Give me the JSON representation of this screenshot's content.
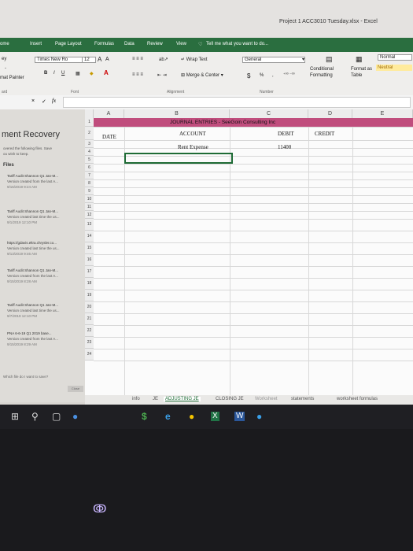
{
  "window": {
    "title": "Project 1 ACC3010 Tuesday.xlsx - Excel"
  },
  "ribbon": {
    "tabs": [
      "ome",
      "Insert",
      "Page Layout",
      "Formulas",
      "Data",
      "Review",
      "View"
    ],
    "tell_me": "Tell me what you want to do...",
    "clipboard": {
      "cut": "ey",
      "copy": "-",
      "format_painter": "mat Painter",
      "group": "ard"
    },
    "font": {
      "name": "Times New Ro",
      "size": "12",
      "grow": "A",
      "shrink": "A",
      "bold": "B",
      "italic": "I",
      "underline": "U",
      "group": "Font"
    },
    "alignment": {
      "wrap": "Wrap Text",
      "merge": "Merge & Center",
      "group": "Alignment"
    },
    "number": {
      "format": "General",
      "currency": "$",
      "percent": "%",
      "comma": ",",
      "group": "Number"
    },
    "styles": {
      "conditional": "Conditional Formatting",
      "format_as": "Format as Table",
      "normal": "Normal",
      "neutral": "Neutral"
    }
  },
  "formula_bar": {
    "cancel": "×",
    "enter": "✓",
    "fx": "fx"
  },
  "recovery": {
    "title": "ment Recovery",
    "line1": "overed the following files. Save",
    "line2": "ou wish to keep.",
    "files_header": "Files",
    "items": [
      {
        "name": "Tariff Audit Shannon Q1 Jan-M...",
        "desc": "Version created from the last A...",
        "time": "9/16/2019 9:24 AM"
      },
      {
        "name": "Tariff Audit Shannon Q1 Jan-M...",
        "desc": "Version created last time the us...",
        "time": "9/1/2019 12:10 PM"
      },
      {
        "name": "https://gdavis.eltra.chrysler.co...",
        "desc": "Version created last time the us...",
        "time": "9/13/2019 9:46 AM"
      },
      {
        "name": "Tariff Audit Shannon Q1 Jan-M...",
        "desc": "Version created from the last A...",
        "time": "9/15/2019 8:28 AM"
      },
      {
        "name": "Tariff Audit Shannon Q1 Jan-M...",
        "desc": "Version created last time the us...",
        "time": "9/7/2019 12:10 PM"
      },
      {
        "name": "PNA 6-6-19 Q1 2019 base...",
        "desc": "Version created from the last A...",
        "time": "9/15/2019 8:29 AM"
      }
    ],
    "footer": "Which file do I want to save?",
    "close": "Close"
  },
  "sheet": {
    "columns": [
      "A",
      "B",
      "C",
      "D",
      "E"
    ],
    "rows": [
      "1",
      "2",
      "3",
      "4",
      "5",
      "6",
      "7",
      "8",
      "9",
      "10",
      "11",
      "12",
      "13",
      "14",
      "15",
      "16",
      "17",
      "18",
      "19",
      "20",
      "21",
      "22",
      "23",
      "24"
    ],
    "title": "JOURNAL ENTRIES - SeeGoin Consulting  Inc",
    "headers": {
      "date": "DATE",
      "account": "ACCOUNT",
      "debit": "DEBIT",
      "credit": "CREDIT"
    },
    "entry": {
      "account": "Rent Expense",
      "debit": "11400"
    }
  },
  "sheet_tabs": [
    "info",
    "JE",
    "ADJUSTING JE",
    "CLOSING JE",
    "Worksheet",
    "statements",
    "worksheet formulas"
  ],
  "taskbar": {
    "start": "⊞",
    "search": "⚲",
    "task_view": "▢",
    "app1": "●",
    "app2": "$",
    "app3": "e",
    "app4": "●",
    "app5": "X",
    "app6": "W",
    "app7": "●"
  },
  "below_screen_glyph": "ↂ",
  "colors": {
    "excel_green": "#2a6e3f",
    "header_pink": "#c04d7d"
  }
}
